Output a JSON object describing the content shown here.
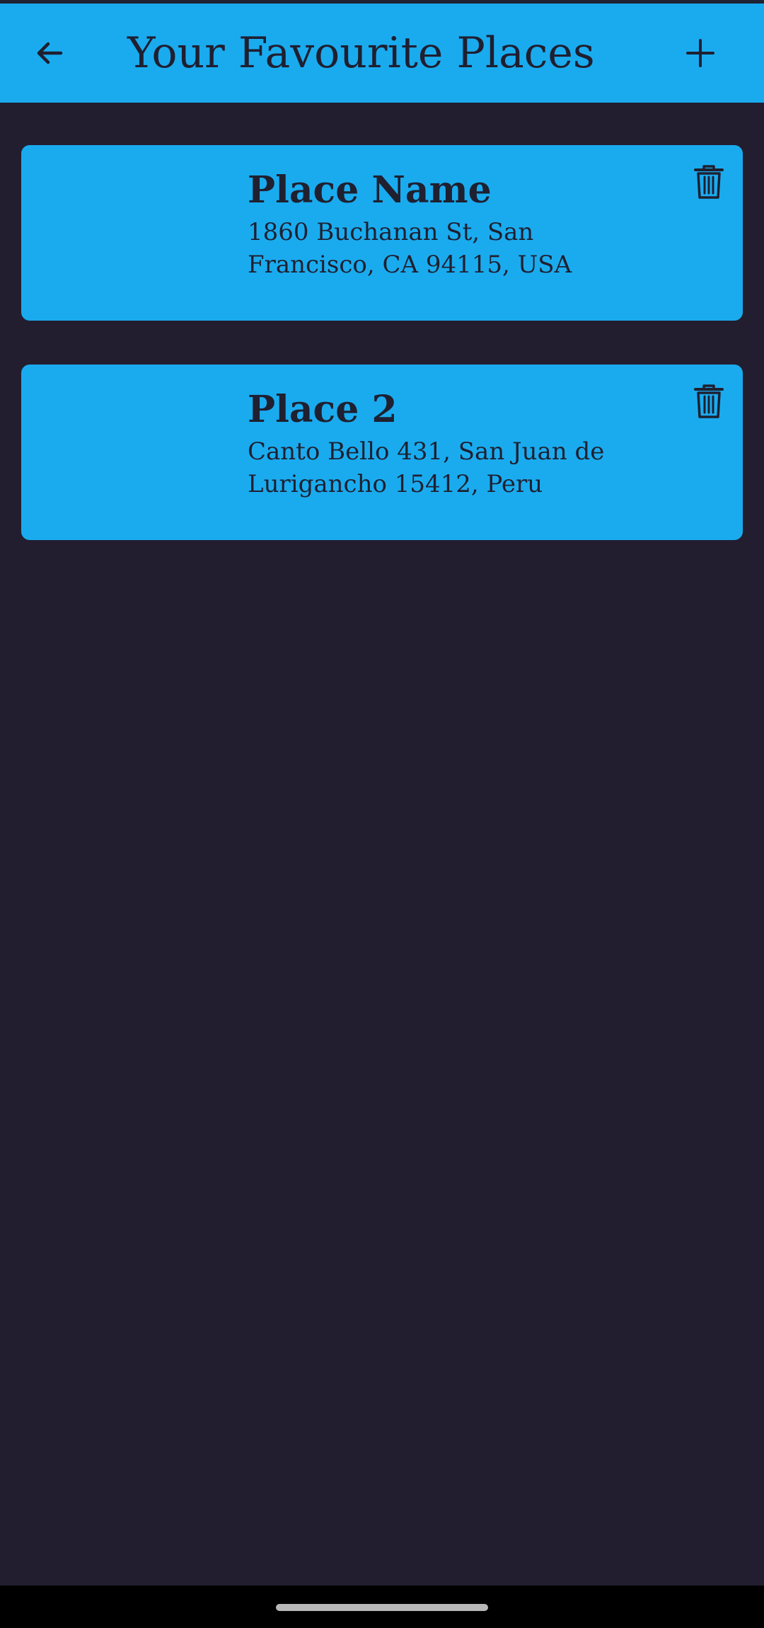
{
  "app_bar": {
    "title": "Your Favourite Places",
    "back_icon": "arrow-back-icon",
    "add_icon": "plus-icon"
  },
  "places": [
    {
      "name": "Place Name",
      "address": "1860 Buchanan St, San Francisco, CA 94115, USA",
      "delete_icon": "trash-icon"
    },
    {
      "name": "Place 2",
      "address": "Canto Bello 431, San Juan de Lurigancho 15412, Peru",
      "delete_icon": "trash-icon"
    }
  ],
  "colors": {
    "app_bar": "#1aabef",
    "card": "#1aabef",
    "background": "#221e30",
    "text": "#1f2030"
  }
}
